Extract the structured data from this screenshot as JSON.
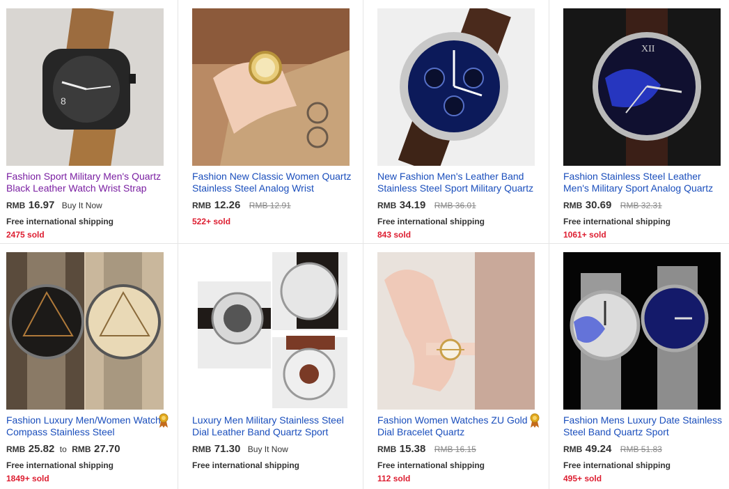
{
  "listings": [
    {
      "title": "Fashion Sport Military Men's Quartz Black Leather Watch Wrist Strap",
      "currency": "RMB",
      "price": "16.97",
      "buy_it_now": "Buy It Now",
      "shipping": "Free international shipping",
      "sold": "2475 sold",
      "image_icon": "watch-photo-brown-strap"
    },
    {
      "title": "Fashion New Classic Women Quartz Stainless Steel Analog Wrist",
      "currency": "RMB",
      "price": "12.26",
      "original_price": "RMB 12.91",
      "sold": "522+ sold",
      "image_icon": "watch-photo-gold-women"
    },
    {
      "title": "New Fashion Men's Leather Band Stainless Steel Sport Military Quartz",
      "currency": "RMB",
      "price": "34.19",
      "original_price": "RMB 36.01",
      "shipping": "Free international shipping",
      "sold": "843 sold",
      "image_icon": "watch-photo-blue-chrono"
    },
    {
      "title": "Fashion Stainless Steel Leather Men's Military Sport Analog Quartz",
      "currency": "RMB",
      "price": "30.69",
      "original_price": "RMB 32.31",
      "shipping": "Free international shipping",
      "sold": "1061+ sold",
      "image_icon": "watch-photo-blue-roman"
    },
    {
      "title": "Fashion Luxury Men/Women Watch Compass Stainless Steel",
      "currency": "RMB",
      "price": "25.82",
      "range_to": "to",
      "currency_to": "RMB",
      "price_to": "27.70",
      "shipping": "Free international shipping",
      "sold": "1849+ sold",
      "image_icon": "watch-photo-compass-pair"
    },
    {
      "title": "Luxury Men Military Stainless Steel Dial Leather Band Quartz Sport",
      "currency": "RMB",
      "price": "71.30",
      "buy_it_now": "Buy It Now",
      "shipping": "Free international shipping",
      "image_icon": "watch-photo-military-white"
    },
    {
      "title": "Fashion Women Watches ZU Gold Dial Bracelet Quartz",
      "currency": "RMB",
      "price": "15.38",
      "original_price": "RMB 16.15",
      "shipping": "Free international shipping",
      "sold": "112 sold",
      "image_icon": "watch-photo-gold-bracelet"
    },
    {
      "title": "Fashion Mens Luxury Date Stainless Steel Band Quartz Sport",
      "currency": "RMB",
      "price": "49.24",
      "original_price": "RMB 51.83",
      "shipping": "Free international shipping",
      "sold": "495+ sold",
      "image_icon": "watch-photo-steel-pair"
    }
  ],
  "colors": {
    "link": "#1a4ebc",
    "visited_link": "#7a1fa2",
    "sold": "#dd1e31",
    "badge": "#e2a81c"
  }
}
